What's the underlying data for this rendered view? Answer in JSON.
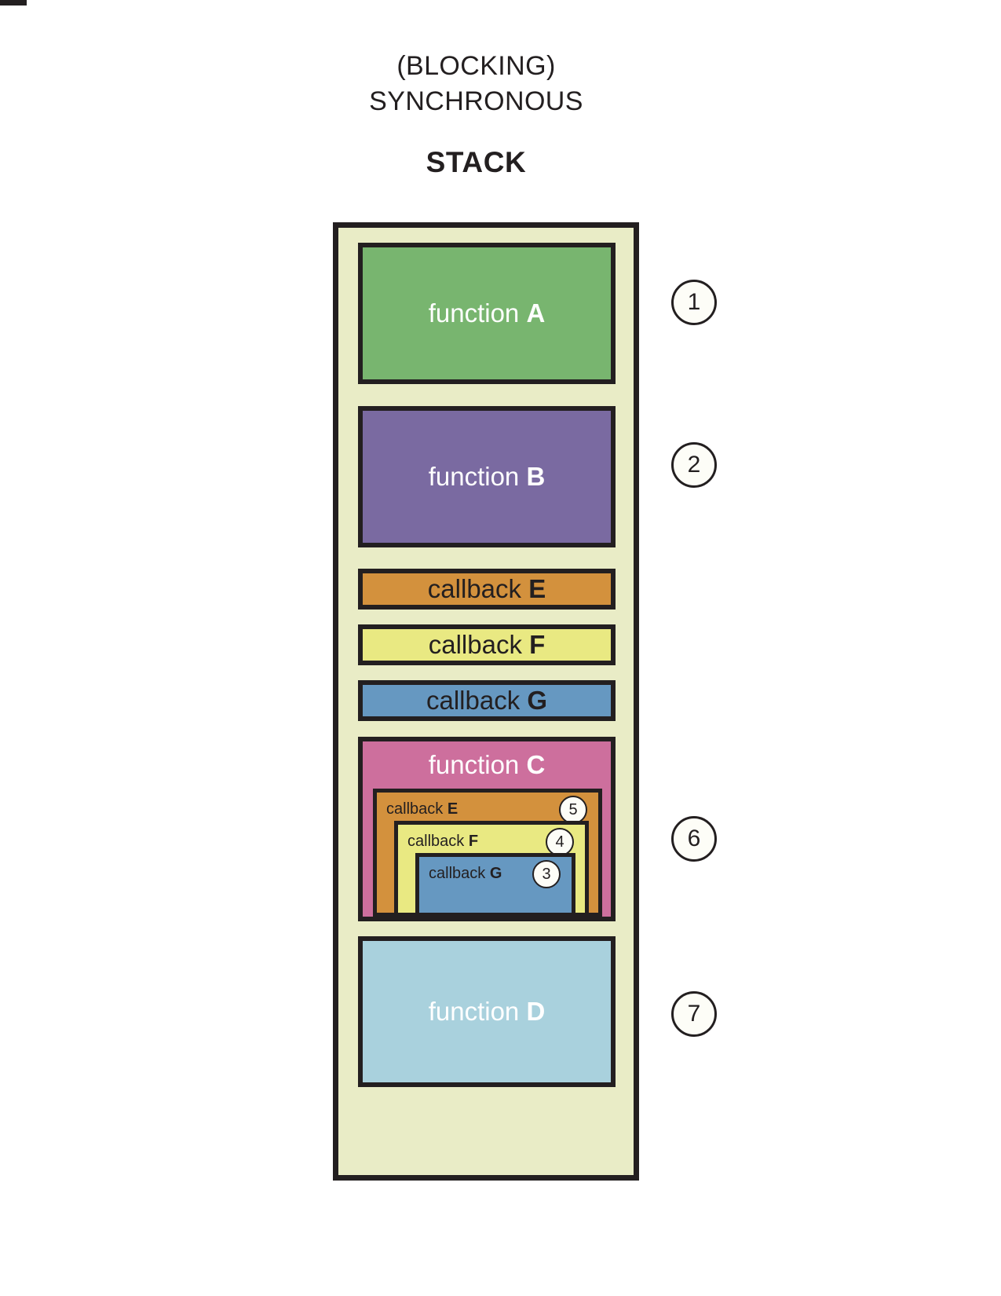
{
  "diagram": {
    "heading_lines": [
      "(BLOCKING)",
      "SYNCHRONOUS"
    ],
    "section_title": "STACK",
    "colors": {
      "background": "#ffffff",
      "stack_fill": "#e9ecc6",
      "outline": "#231f20",
      "function_a": "#78b56f",
      "function_b": "#7a6aa1",
      "function_c": "#cd6f9d",
      "function_d": "#a9d1dd",
      "callback_e": "#d3913d",
      "callback_f": "#e9e982",
      "callback_g": "#6698c1",
      "circle_fill": "#fdfdf7"
    }
  },
  "stack": {
    "frames": [
      {
        "id": "function-a",
        "label_prefix": "function ",
        "label_bold": "A",
        "color": "#78b56f",
        "step": "1"
      },
      {
        "id": "function-b",
        "label_prefix": "function ",
        "label_bold": "B",
        "color": "#7a6aa1",
        "step": "2"
      },
      {
        "id": "callback-e-bar",
        "label_prefix": "callback ",
        "label_bold": "E",
        "color": "#d3913d",
        "step": ""
      },
      {
        "id": "callback-f-bar",
        "label_prefix": "callback ",
        "label_bold": "F",
        "color": "#e9e982",
        "step": ""
      },
      {
        "id": "callback-g-bar",
        "label_prefix": "callback ",
        "label_bold": "G",
        "color": "#6698c1",
        "step": ""
      },
      {
        "id": "function-c",
        "label_prefix": "function ",
        "label_bold": "C",
        "color": "#cd6f9d",
        "step": "6"
      },
      {
        "id": "function-d",
        "label_prefix": "function ",
        "label_bold": "D",
        "color": "#a9d1dd",
        "step": "7"
      }
    ],
    "nested_in_function_c": [
      {
        "id": "callback-e-nested",
        "label_prefix": "callback ",
        "label_bold": "E",
        "color": "#d3913d",
        "step": "5"
      },
      {
        "id": "callback-f-nested",
        "label_prefix": "callback ",
        "label_bold": "F",
        "color": "#e9e982",
        "step": "4"
      },
      {
        "id": "callback-g-nested",
        "label_prefix": "callback ",
        "label_bold": "G",
        "color": "#6698c1",
        "step": "3"
      }
    ]
  },
  "labels": {
    "function_a_prefix": "function ",
    "function_a_bold": "A",
    "function_b_prefix": "function ",
    "function_b_bold": "B",
    "function_c_prefix": "function ",
    "function_c_bold": "C",
    "function_d_prefix": "function ",
    "function_d_bold": "D",
    "callback_e_bar_prefix": "callback ",
    "callback_e_bar_bold": "E",
    "callback_f_bar_prefix": "callback ",
    "callback_f_bar_bold": "F",
    "callback_g_bar_prefix": "callback ",
    "callback_g_bar_bold": "G",
    "callback_e_nest_prefix": "callback ",
    "callback_e_nest_bold": "E",
    "callback_f_nest_prefix": "callback ",
    "callback_f_nest_bold": "F",
    "callback_g_nest_prefix": "callback ",
    "callback_g_nest_bold": "G"
  },
  "steps": {
    "s1": "1",
    "s2": "2",
    "s3": "3",
    "s4": "4",
    "s5": "5",
    "s6": "6",
    "s7": "7"
  },
  "heading": {
    "line1": "(BLOCKING)",
    "line2": "SYNCHRONOUS",
    "stack": "STACK"
  }
}
